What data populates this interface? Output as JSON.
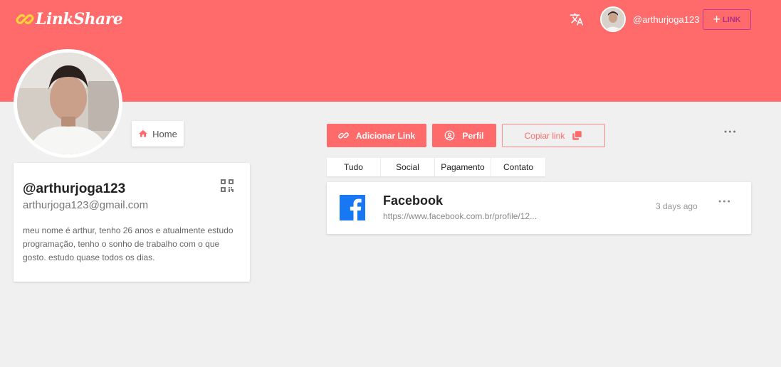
{
  "header": {
    "logo_text": "LinkShare",
    "username": "@arthurjoga123",
    "add_link_label": "LINK"
  },
  "nav": {
    "home_label": "Home"
  },
  "profile": {
    "username": "@arthurjoga123",
    "email": "arthurjoga123@gmail.com",
    "bio": "meu nome é arthur, tenho 26 anos e atualmente estudo programação, tenho o sonho de trabalho com o que gosto. estudo quase todos os dias."
  },
  "actions": {
    "add_link": "Adicionar Link",
    "profile": "Perfil",
    "copy_link": "Copiar link"
  },
  "tabs": [
    "Tudo",
    "Social",
    "Pagamento",
    "Contato"
  ],
  "links": [
    {
      "title": "Facebook",
      "url": "https://www.facebook.com.br/profile/12...",
      "time": "3 days ago",
      "icon": "facebook-icon"
    }
  ],
  "colors": {
    "accent": "#ff6b6b",
    "background": "#f0f0f0",
    "facebook": "#1877f2"
  }
}
